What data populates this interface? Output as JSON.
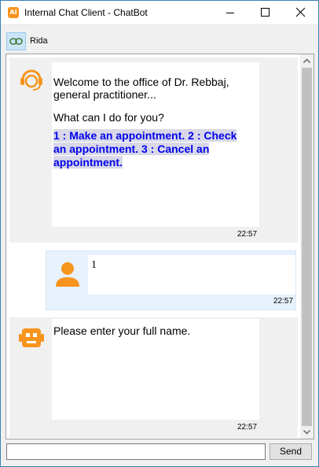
{
  "window": {
    "title": "Internal Chat Client - ChatBot",
    "app_icon_text": "AI"
  },
  "toolbar": {
    "contact_label": "Rida"
  },
  "messages": [
    {
      "sender": "agent",
      "icon": "support-agent-icon",
      "line1": "Welcome to the office of Dr. Rebbaj,",
      "line2": "general practitioner...",
      "line3": "What can I do for you?",
      "options_line1": "1 : Make an appointment. 2 : Check",
      "options_line2": "an appointment. 3 : Cancel an",
      "options_line3": "appointment.",
      "time": "22:57"
    },
    {
      "sender": "user",
      "icon": "user-icon",
      "text": "1",
      "time": "22:57"
    },
    {
      "sender": "bot",
      "icon": "robot-icon",
      "text": "Please enter your full name.",
      "time": "22:57"
    }
  ],
  "compose": {
    "value": "",
    "send_label": "Send"
  },
  "colors": {
    "accent": "#f7941d",
    "option_text": "#0000ee",
    "user_bubble": "#e8f2fc"
  }
}
